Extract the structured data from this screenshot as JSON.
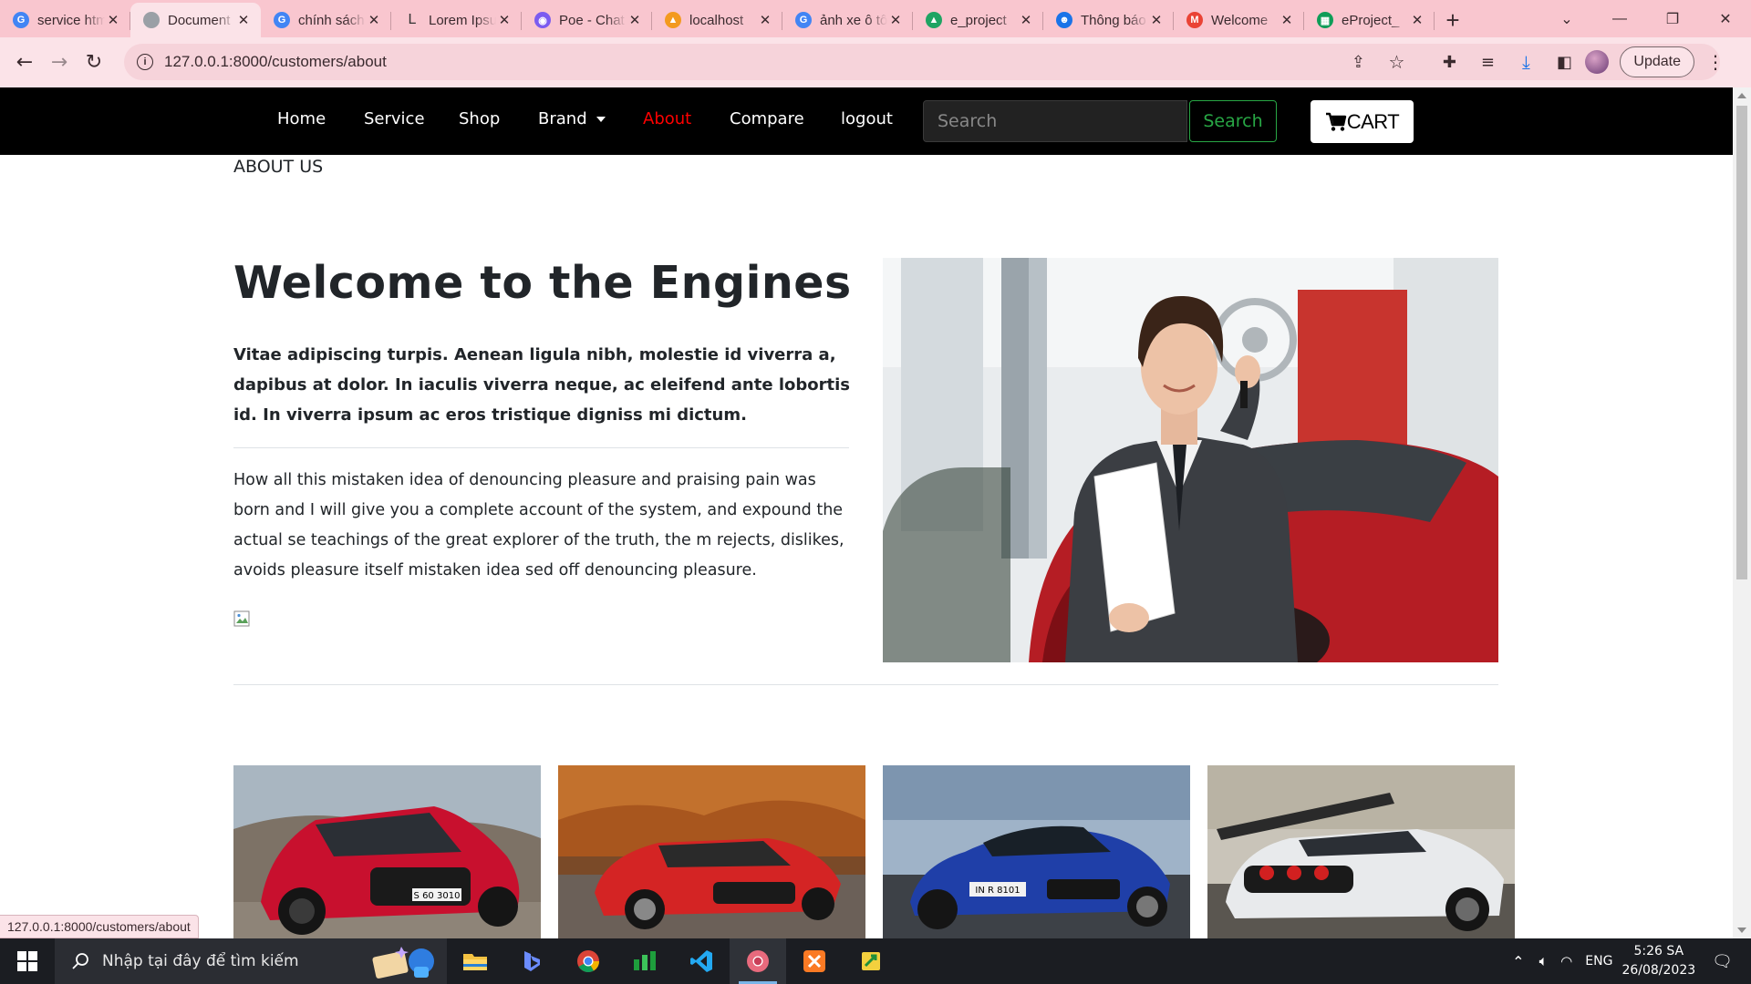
{
  "browser": {
    "tabs": [
      {
        "title": "service html",
        "favicon": "google-icon",
        "active": false
      },
      {
        "title": "Document",
        "favicon": "globe-icon",
        "active": true
      },
      {
        "title": "chính sách",
        "favicon": "google-icon",
        "active": false
      },
      {
        "title": "Lorem Ipsum",
        "favicon": "lorem-icon",
        "active": false
      },
      {
        "title": "Poe - Chat",
        "favicon": "poe-icon",
        "active": false
      },
      {
        "title": "localhost",
        "favicon": "phpmyadmin-icon",
        "active": false
      },
      {
        "title": "ảnh xe ô tô",
        "favicon": "google-icon",
        "active": false
      },
      {
        "title": "e_project",
        "favicon": "drive-icon",
        "active": false
      },
      {
        "title": "Thông báo",
        "favicon": "contacts-icon",
        "active": false
      },
      {
        "title": "Welcome",
        "favicon": "gmail-icon",
        "active": false
      },
      {
        "title": "eProject_",
        "favicon": "sheets-icon",
        "active": false
      }
    ],
    "url": "127.0.0.1:8000/customers/about",
    "update_label": "Update",
    "status_url": "127.0.0.1:8000/customers/about"
  },
  "nav": {
    "items": [
      {
        "label": "Home"
      },
      {
        "label": "Service"
      },
      {
        "label": "Shop"
      },
      {
        "label": "Brand"
      },
      {
        "label": "About"
      },
      {
        "label": "Compare"
      },
      {
        "label": "logout"
      }
    ],
    "active": "About",
    "search_placeholder": "Search",
    "search_button": "Search",
    "cart_label": "CART"
  },
  "page": {
    "section_title": "ABOUT US",
    "heading": "Welcome to the Engines",
    "lead": "Vitae adipiscing turpis. Aenean ligula nibh, molestie id viverra a, dapibus at dolor. In iaculis viverra neque, ac eleifend ante lobortis id. In viverra ipsum ac eros tristique digniss mi dictum.",
    "body": "How all this mistaken idea of denouncing pleasure and praising pain was born and I will give you a complete account of the system, and expound the actual se teachings of the great explorer of the truth, the m rejects, dislikes, avoids pleasure itself mistaken idea sed off denouncing pleasure.",
    "hero_plate": "",
    "cars": [
      {
        "color": "red",
        "plate": "S 60 3010"
      },
      {
        "color": "red",
        "plate": ""
      },
      {
        "color": "blue",
        "plate": "IN R 8101"
      },
      {
        "color": "white",
        "plate": ""
      }
    ]
  },
  "taskbar": {
    "search_placeholder": "Nhập tại đây để tìm kiếm",
    "language": "ENG",
    "time": "5:26 SA",
    "date": "26/08/2023"
  },
  "colors": {
    "tab_bar": "#f9c6cf",
    "toolbar": "#fbe3e8",
    "nav_bg": "#000000",
    "nav_active": "#ff0000",
    "search_button": "#28a745"
  }
}
